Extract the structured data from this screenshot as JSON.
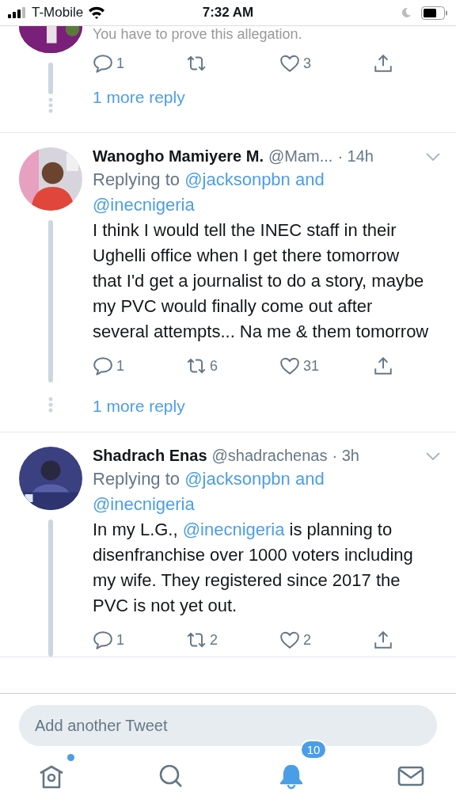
{
  "status_bar": {
    "carrier": "T-Mobile",
    "time": "7:32 AM"
  },
  "top_thread": {
    "text": "You have to prove this allegation.",
    "actions": {
      "replies": "1",
      "likes": "3"
    },
    "more_replies": "1 more reply"
  },
  "tweets": [
    {
      "name": "Wanogho Mamiyere M.",
      "handle": "@Mam...",
      "time": "· 14h",
      "replying": {
        "label": "Replying to",
        "targets": [
          "@jacksonpbn",
          "@inecnigeria"
        ],
        "joiner": "and"
      },
      "text": [
        {
          "kind": "plain",
          "text": "I think I would tell the INEC staff in their Ughelli office when I get there tomorrow that I'd get a journalist to do a story, maybe my PVC would finally come out after several attempts... Na me & them tomorrow"
        }
      ],
      "actions": {
        "replies": "1",
        "retweets": "6",
        "likes": "31"
      },
      "more_replies": "1 more reply"
    },
    {
      "name": "Shadrach Enas",
      "handle": "@shadrachenas",
      "time": "· 3h",
      "replying": {
        "label": "Replying to",
        "targets": [
          "@jacksonpbn",
          "@inecnigeria"
        ],
        "joiner": "and"
      },
      "text": [
        {
          "kind": "plain",
          "text": "In my L.G., "
        },
        {
          "kind": "mention",
          "text": "@inecnigeria"
        },
        {
          "kind": "plain",
          "text": " is planning to disenfranchise over 1000 voters including my wife. They registered since 2017 the PVC is not yet out."
        }
      ],
      "actions": {
        "replies": "1",
        "retweets": "2",
        "likes": "2"
      }
    }
  ],
  "composer": {
    "placeholder": "Add another Tweet"
  },
  "tabs": [
    {
      "kind": "home",
      "selected": false,
      "unread": true
    },
    {
      "kind": "search",
      "selected": false
    },
    {
      "kind": "notifications",
      "selected": true,
      "badge": "10"
    },
    {
      "kind": "messages",
      "selected": false
    }
  ]
}
